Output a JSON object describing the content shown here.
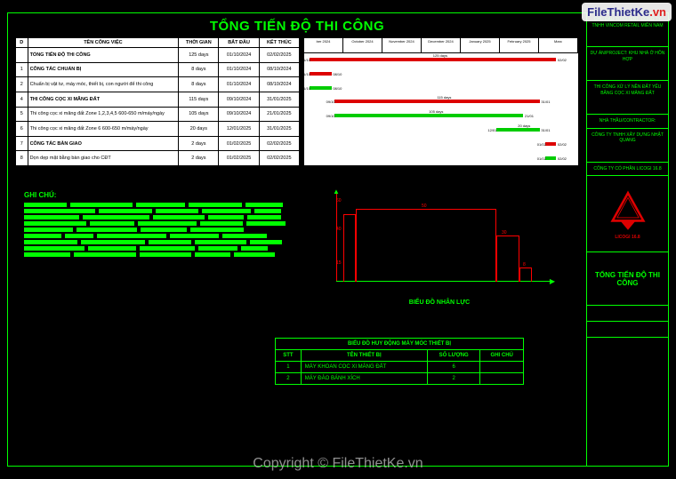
{
  "watermark": {
    "brand_prefix": "File",
    "brand_main": "ThietKe",
    "brand_suffix": ".vn",
    "copyright": "Copyright © FileThietKe.vn"
  },
  "page_title": "TỔNG TIẾN ĐỘ THI CÔNG",
  "task_headers": {
    "id": "D",
    "name": "TÊN CÔNG VIỆC",
    "dur": "THỜI GIAN",
    "start": "BẮT ĐẦU",
    "end": "KẾT THÚC"
  },
  "tasks": [
    {
      "id": "",
      "name": "TỔNG TIẾN ĐỘ THI CÔNG",
      "dur": "125 days",
      "start": "01/10/2024",
      "end": "02/02/2025",
      "bold": true
    },
    {
      "id": "1",
      "name": "CÔNG TÁC CHUẨN BỊ",
      "dur": "8 days",
      "start": "01/10/2024",
      "end": "08/10/2024",
      "bold": true
    },
    {
      "id": "2",
      "name": "Chuẩn bị vật tư, máy móc, thiết bị, con người để thi công",
      "dur": "8 days",
      "start": "01/10/2024",
      "end": "08/10/2024"
    },
    {
      "id": "4",
      "name": "THI CÔNG CỌC XI MĂNG ĐẤT",
      "dur": "115 days",
      "start": "09/10/2024",
      "end": "31/01/2025",
      "bold": true
    },
    {
      "id": "5",
      "name": "Thi công cọc xi măng đất Zone 1,2,3,4,5 600-650 m/máy/ngày",
      "dur": "105 days",
      "start": "09/10/2024",
      "end": "21/01/2025"
    },
    {
      "id": "6",
      "name": "Thi công cọc xi măng đất Zone 6 600-650 m/máy/ngày",
      "dur": "20 days",
      "start": "12/01/2025",
      "end": "31/01/2025"
    },
    {
      "id": "7",
      "name": "CÔNG TÁC BÀN GIAO",
      "dur": "2 days",
      "start": "01/02/2025",
      "end": "02/02/2025",
      "bold": true
    },
    {
      "id": "8",
      "name": "Dọn dẹp mặt bằng bàn giao cho CĐT",
      "dur": "2 days",
      "start": "01/02/2025",
      "end": "02/02/2025"
    }
  ],
  "gantt_months": [
    "ber 2024",
    "October 2024",
    "November 2024",
    "December 2024",
    "January 2025",
    "February 2025",
    "Marc"
  ],
  "chart_data": {
    "type": "gantt",
    "title": "TỔNG TIẾN ĐỘ THI CÔNG",
    "x_start": "01/10/2024",
    "x_end": "02/02/2025",
    "bars": [
      {
        "task": 0,
        "start_pct": 2,
        "end_pct": 92,
        "color": "red",
        "label": "125 days",
        "dl": "01/10",
        "dr": "02/02"
      },
      {
        "task": 1,
        "start_pct": 2,
        "end_pct": 10,
        "color": "red",
        "label": "",
        "dl": "01/10",
        "dr": "08/10"
      },
      {
        "task": 2,
        "start_pct": 2,
        "end_pct": 10,
        "color": "green",
        "label": "",
        "dl": "01/10",
        "dr": "08/10"
      },
      {
        "task": 3,
        "start_pct": 11,
        "end_pct": 86,
        "color": "red",
        "label": "115 days",
        "dl": "09/10",
        "dr": "31/01"
      },
      {
        "task": 4,
        "start_pct": 11,
        "end_pct": 80,
        "color": "green",
        "label": "105 days",
        "dl": "09/10",
        "dr": "21/01"
      },
      {
        "task": 5,
        "start_pct": 70,
        "end_pct": 86,
        "color": "green",
        "label": "20 days",
        "dl": "12/01",
        "dr": "31/01"
      },
      {
        "task": 6,
        "start_pct": 88,
        "end_pct": 92,
        "color": "red",
        "label": "",
        "dl": "01/02",
        "dr": "02/02"
      },
      {
        "task": 7,
        "start_pct": 88,
        "end_pct": 92,
        "color": "green",
        "label": "",
        "dl": "01/02",
        "dr": "02/02"
      }
    ]
  },
  "notes_title": "GHI CHÚ:",
  "notes_segments": [
    [
      48,
      70,
      55,
      60,
      42
    ],
    [
      80,
      60,
      48,
      55,
      30
    ],
    [
      62,
      75,
      58,
      40,
      38
    ],
    [
      70,
      50,
      66,
      48,
      44
    ],
    [
      55,
      68,
      52,
      60
    ],
    [
      42,
      32,
      78,
      55,
      50
    ],
    [
      60,
      72,
      48,
      58,
      36
    ],
    [
      68,
      54,
      62,
      44,
      30
    ],
    [
      52,
      70,
      58,
      40,
      46
    ]
  ],
  "manpower": {
    "title": "BIỂU ĐỒ NHÂN LỰC",
    "y_ticks": [
      "60",
      "40",
      "15"
    ],
    "values": [
      "50",
      "30",
      "8"
    ]
  },
  "equip_title": "BIỂU ĐỒ HUY ĐỘNG MÁY MÓC THIẾT BỊ",
  "equip_headers": {
    "stt": "STT",
    "name": "TÊN THIẾT BỊ",
    "qty": "SỐ LƯỢNG",
    "note": "GHI CHÚ"
  },
  "equip_rows": [
    {
      "stt": "1",
      "name": "MÁY KHOAN CỌC XI MĂNG ĐẤT",
      "qty": "6",
      "note": ""
    },
    {
      "stt": "2",
      "name": "MÁY ĐÀO BÁNH XÍCH",
      "qty": "2",
      "note": ""
    }
  ],
  "titleblock": {
    "r1": "CHỦ ĐẦU TƯ/CLIENT: CÔNG TY TNHH VINCOM RETAIL MIỀN NAM",
    "r2": "DỰ ÁN/PROJECT: KHU NHÀ Ở HỖN HỢP",
    "r3": "THI CÔNG XỬ LÝ NỀN ĐẤT YẾU BẰNG CỌC XI MĂNG ĐẤT",
    "r4": "NHÀ THẦU/CONTRACTOR:",
    "r5": "CÔNG TY TNHH XÂY DỰNG NHẬT QUANG",
    "logo_label": "CÔNG TY CỔ PHẦN LICOGI 16.8",
    "logo_brand": "LICOGI 16.8",
    "sheet_title": "TỔNG TIẾN ĐỘ THI CÔNG"
  }
}
